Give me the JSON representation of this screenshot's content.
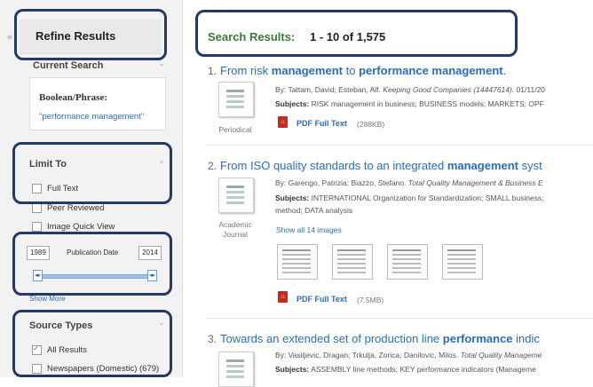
{
  "sidebar": {
    "collapse_glyph": "«",
    "refine_title": "Refine Results",
    "current_search": {
      "title": "Current Search",
      "label": "Boolean/Phrase:",
      "value": "\"performance management\""
    },
    "limit_to": {
      "title": "Limit To",
      "items": [
        {
          "label": "Full Text",
          "checked": false
        },
        {
          "label": "Peer Reviewed",
          "checked": false
        },
        {
          "label": "Image Quick View",
          "checked": false
        }
      ]
    },
    "publication_date": {
      "from": "1989",
      "label": "Publication Date",
      "to": "2014"
    },
    "show_more": "Show More",
    "source_types": {
      "title": "Source Types",
      "items": [
        {
          "label": "All Results",
          "checked": true
        },
        {
          "label": "Newspapers (Domestic) (679)",
          "checked": false
        }
      ]
    }
  },
  "main": {
    "results_label": "Search Results:",
    "results_count": "1 - 10 of 1,575",
    "results": [
      {
        "num": "1.",
        "title_parts": [
          "From risk ",
          "management",
          " to ",
          "performance management",
          "."
        ],
        "byline": "By: Tattam, David; Esteban, Alf.",
        "source": "Keeping Good Companies (14447614).",
        "date": "01/11/20",
        "subjects_label": "Subjects:",
        "subjects": "RISK management in business; BUSINESS models; MARKETS; OPF",
        "type": "Periodical",
        "pdf_label": "PDF Full Text",
        "pdf_size": "(288KB)"
      },
      {
        "num": "2.",
        "title_parts": [
          "From ISO quality standards to an integrated ",
          "management",
          " syst"
        ],
        "byline": "By: Garengo, Patrizia; Biazzo, Stefano.",
        "source": "Total Quality Management & Business E",
        "subjects_label": "Subjects:",
        "subjects": "INTERNATIONAL Organization for Standardization; SMALL business;",
        "subjects_line2": "method; DATA analysis",
        "type_line1": "Academic",
        "type_line2": "Journal",
        "show_images": "Show all 14 images",
        "pdf_label": "PDF Full Text",
        "pdf_size": "(7.5MB)"
      },
      {
        "num": "3.",
        "title_parts": [
          "Towards an extended set of production line ",
          "performance",
          " indic"
        ],
        "byline": "By: Vasiljevic, Dragan; Trkulja, Zorica; Danilovic, Milos.",
        "source": "Total Quality Manageme",
        "subjects_label": "Subjects:",
        "subjects": "ASSEMBLY line methods; KEY performance indicators (Manageme"
      }
    ]
  }
}
